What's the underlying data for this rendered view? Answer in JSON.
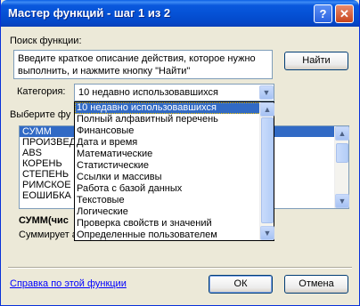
{
  "window": {
    "title": "Мастер функций - шаг 1 из 2",
    "help_glyph": "?",
    "close_glyph": "✕"
  },
  "search": {
    "label": "Поиск функции:",
    "description": "Введите краткое описание действия, которое нужно выполнить, и нажмите кнопку \"Найти\"",
    "find_button": "Найти"
  },
  "category": {
    "label": "Категория:",
    "selected": "10 недавно использовавшихся",
    "options": [
      "10 недавно использовавшихся",
      "Полный алфавитный перечень",
      "Финансовые",
      "Дата и время",
      "Математические",
      "Статистические",
      "Ссылки и массивы",
      "Работа с базой данных",
      "Текстовые",
      "Логические",
      "Проверка свойств и значений",
      "Определенные пользователем"
    ]
  },
  "functions": {
    "label": "Выберите фу",
    "items": [
      "СУММ",
      "ПРОИЗВЕД",
      "ABS",
      "КОРЕНЬ",
      "СТЕПЕНЬ",
      "РИМСКОЕ",
      "ЕОШИБКА"
    ],
    "selected": "СУММ",
    "signature": "СУММ(чис",
    "description": "Суммирует а"
  },
  "footer": {
    "help_link": "Справка по этой функции",
    "ok_button": "ОК",
    "cancel_button": "Отмена"
  }
}
